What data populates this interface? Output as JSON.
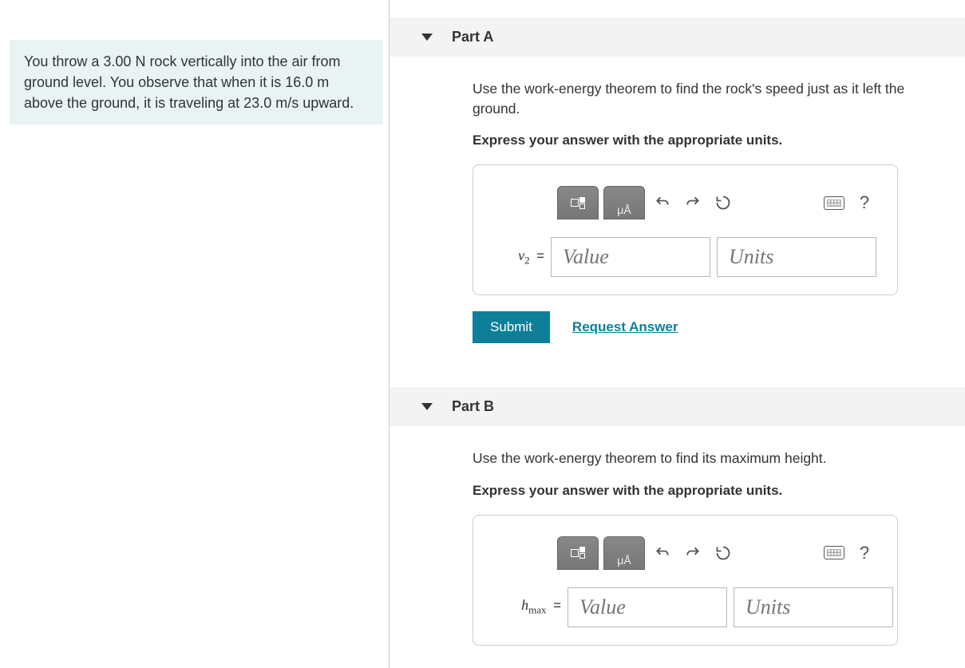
{
  "problem": "You throw a 3.00 N rock vertically into the air from ground level. You observe that when it is 16.0 m above the ground, it is traveling at 23.0 m/s upward.",
  "partA": {
    "header": "Part A",
    "question": "Use the work-energy theorem to find the rock's speed just as it left the ground.",
    "instruction": "Express your answer with the appropriate units.",
    "var_main": "v",
    "var_sub": "2",
    "eq": "=",
    "value_placeholder": "Value",
    "units_placeholder": "Units",
    "submit": "Submit",
    "request": "Request Answer",
    "help": "?"
  },
  "partB": {
    "header": "Part B",
    "question": "Use the work-energy theorem to find its maximum height.",
    "instruction": "Express your answer with the appropriate units.",
    "var_main": "h",
    "var_sub": "max",
    "eq": "=",
    "value_placeholder": "Value",
    "units_placeholder": "Units",
    "help": "?"
  },
  "tool_special_label": "μÅ"
}
